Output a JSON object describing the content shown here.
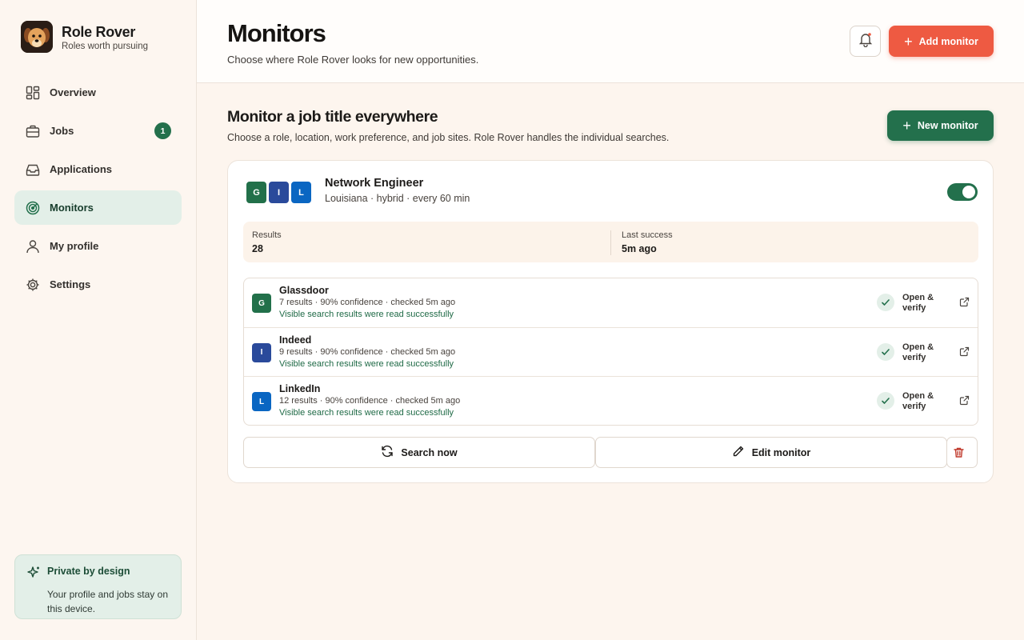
{
  "brand": {
    "name": "Role Rover",
    "tagline": "Roles worth pursuing"
  },
  "nav": {
    "items": [
      {
        "label": "Overview",
        "icon": "grid-icon"
      },
      {
        "label": "Jobs",
        "icon": "briefcase-icon",
        "badge": "1"
      },
      {
        "label": "Applications",
        "icon": "inbox-icon"
      },
      {
        "label": "Monitors",
        "icon": "radar-icon",
        "active": true
      },
      {
        "label": "My profile",
        "icon": "user-icon"
      },
      {
        "label": "Settings",
        "icon": "gear-icon"
      }
    ]
  },
  "privacy": {
    "title": "Private by design",
    "text": "Your profile and jobs stay on this device."
  },
  "header": {
    "title": "Monitors",
    "subtitle": "Choose where Role Rover looks for new opportunities.",
    "add_label": "Add monitor"
  },
  "section": {
    "title": "Monitor a job title everywhere",
    "subtitle": "Choose a role, location, work preference, and job sites. Role Rover handles the individual searches.",
    "new_label": "New monitor"
  },
  "monitor": {
    "chips": [
      "G",
      "I",
      "L"
    ],
    "title": "Network Engineer",
    "meta": "Louisiana · hybrid · every 60 min",
    "enabled": true,
    "stats": {
      "results_label": "Results",
      "results_value": "28",
      "success_label": "Last success",
      "success_value": "5m ago"
    },
    "sites": [
      {
        "logo": "G",
        "name": "Glassdoor",
        "meta": "7 results · 90% confidence · checked 5m ago",
        "status": "Visible search results were read successfully",
        "action": "Open & verify"
      },
      {
        "logo": "I",
        "name": "Indeed",
        "meta": "9 results · 90% confidence · checked 5m ago",
        "status": "Visible search results were read successfully",
        "action": "Open & verify"
      },
      {
        "logo": "L",
        "name": "LinkedIn",
        "meta": "12 results · 90% confidence · checked 5m ago",
        "status": "Visible search results were read successfully",
        "action": "Open & verify"
      }
    ],
    "search_label": "Search now",
    "edit_label": "Edit monitor"
  },
  "colors": {
    "accent_red": "#ee5a42",
    "accent_green": "#23704c",
    "glassdoor": "#22704a",
    "indeed": "#2a4a9b",
    "linkedin": "#0a66c2"
  }
}
